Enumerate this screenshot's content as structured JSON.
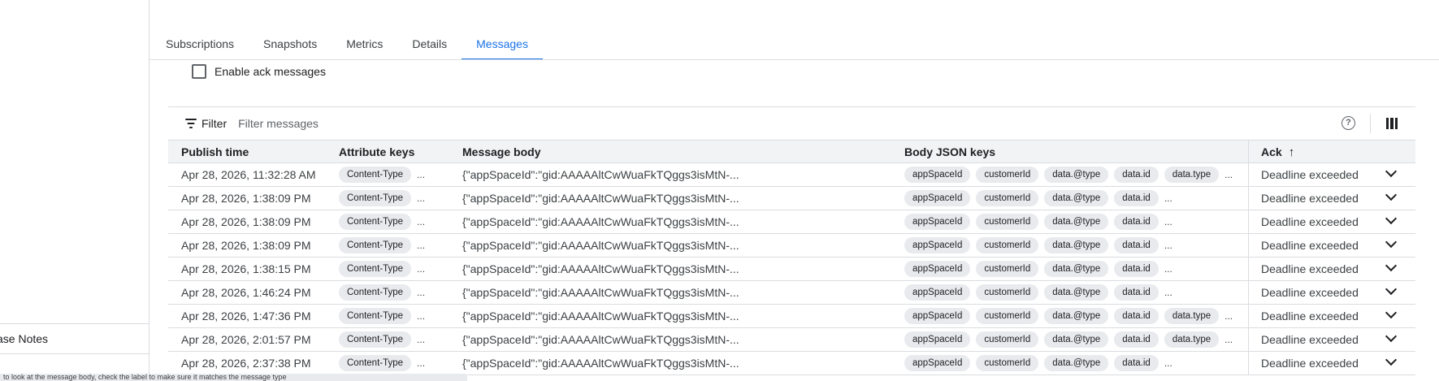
{
  "sidebar": {
    "item_label": "ase Notes"
  },
  "tooltip": {
    "text": "to look at the message body, check the label to make sure it matches the message type"
  },
  "tabs": [
    {
      "label": "Subscriptions",
      "active": false
    },
    {
      "label": "Snapshots",
      "active": false
    },
    {
      "label": "Metrics",
      "active": false
    },
    {
      "label": "Details",
      "active": false
    },
    {
      "label": "Messages",
      "active": true
    }
  ],
  "ack_toggle": {
    "label": "Enable ack messages",
    "checked": false
  },
  "filter": {
    "label": "Filter",
    "placeholder": "Filter messages",
    "help_glyph": "?"
  },
  "table": {
    "headers": {
      "publish_time": "Publish time",
      "attribute_keys": "Attribute keys",
      "message_body": "Message body",
      "body_json_keys": "Body JSON keys",
      "ack": "Ack",
      "sort_glyph": "↑"
    },
    "rows": [
      {
        "publish_time": "Apr 28, 2026, 11:32:28 AM",
        "attr": "Content-Type",
        "body": "{\"appSpaceId\":\"gid:AAAAAltCwWuaFkTQggs3isMtN-...",
        "keys": [
          "appSpaceId",
          "customerId",
          "data.@type",
          "data.id",
          "data.type"
        ],
        "keys_more": "...",
        "ack": "Deadline exceeded"
      },
      {
        "publish_time": "Apr 28, 2026, 1:38:09 PM",
        "attr": "Content-Type",
        "body": "{\"appSpaceId\":\"gid:AAAAAltCwWuaFkTQggs3isMtN-...",
        "keys": [
          "appSpaceId",
          "customerId",
          "data.@type",
          "data.id"
        ],
        "keys_more": "...",
        "ack": "Deadline exceeded"
      },
      {
        "publish_time": "Apr 28, 2026, 1:38:09 PM",
        "attr": "Content-Type",
        "body": "{\"appSpaceId\":\"gid:AAAAAltCwWuaFkTQggs3isMtN-...",
        "keys": [
          "appSpaceId",
          "customerId",
          "data.@type",
          "data.id"
        ],
        "keys_more": "...",
        "ack": "Deadline exceeded"
      },
      {
        "publish_time": "Apr 28, 2026, 1:38:09 PM",
        "attr": "Content-Type",
        "body": "{\"appSpaceId\":\"gid:AAAAAltCwWuaFkTQggs3isMtN-...",
        "keys": [
          "appSpaceId",
          "customerId",
          "data.@type",
          "data.id"
        ],
        "keys_more": "...",
        "ack": "Deadline exceeded"
      },
      {
        "publish_time": "Apr 28, 2026, 1:38:15 PM",
        "attr": "Content-Type",
        "body": "{\"appSpaceId\":\"gid:AAAAAltCwWuaFkTQggs3isMtN-...",
        "keys": [
          "appSpaceId",
          "customerId",
          "data.@type",
          "data.id"
        ],
        "keys_more": "...",
        "ack": "Deadline exceeded"
      },
      {
        "publish_time": "Apr 28, 2026, 1:46:24 PM",
        "attr": "Content-Type",
        "body": "{\"appSpaceId\":\"gid:AAAAAltCwWuaFkTQggs3isMtN-...",
        "keys": [
          "appSpaceId",
          "customerId",
          "data.@type",
          "data.id"
        ],
        "keys_more": "...",
        "ack": "Deadline exceeded"
      },
      {
        "publish_time": "Apr 28, 2026, 1:47:36 PM",
        "attr": "Content-Type",
        "body": "{\"appSpaceId\":\"gid:AAAAAltCwWuaFkTQggs3isMtN-...",
        "keys": [
          "appSpaceId",
          "customerId",
          "data.@type",
          "data.id",
          "data.type"
        ],
        "keys_more": "...",
        "ack": "Deadline exceeded"
      },
      {
        "publish_time": "Apr 28, 2026, 2:01:57 PM",
        "attr": "Content-Type",
        "body": "{\"appSpaceId\":\"gid:AAAAAltCwWuaFkTQggs3isMtN-...",
        "keys": [
          "appSpaceId",
          "customerId",
          "data.@type",
          "data.id",
          "data.type"
        ],
        "keys_more": "...",
        "ack": "Deadline exceeded"
      },
      {
        "publish_time": "Apr 28, 2026, 2:37:38 PM",
        "attr": "Content-Type",
        "body": "{\"appSpaceId\":\"gid:AAAAAltCwWuaFkTQggs3isMtN-...",
        "keys": [
          "appSpaceId",
          "customerId",
          "data.@type",
          "data.id"
        ],
        "keys_more": "...",
        "ack": "Deadline exceeded"
      }
    ],
    "attr_more": "..."
  },
  "colors": {
    "accent": "#1a73e8",
    "chip_bg": "#e8eaed",
    "header_bg": "#f1f3f4",
    "border": "#dadce0"
  },
  "icons": [
    "filter-icon",
    "help-icon",
    "columns-icon",
    "chevron-down-icon",
    "sort-arrow-up-icon",
    "checkbox-icon"
  ]
}
